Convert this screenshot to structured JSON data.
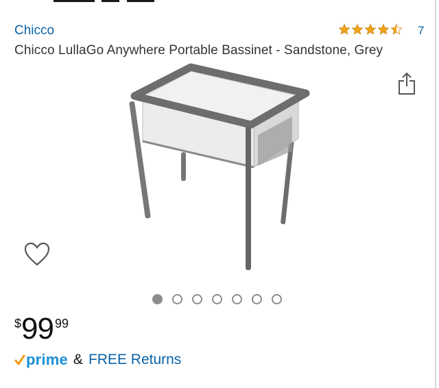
{
  "product": {
    "brand": "Chicco",
    "title": "Chicco LullaGo Anywhere Portable Bassinet - Sandstone, Grey",
    "rating": {
      "stars": 4.5,
      "count": "7"
    },
    "image_alt": "Chicco LullaGo Anywhere Portable Bassinet",
    "carousel": {
      "total": 7,
      "active_index": 0
    },
    "price": {
      "symbol": "$",
      "whole": "99",
      "fraction": "99"
    },
    "shipping": {
      "prime_label": "prime",
      "connector": "&",
      "returns_label": "FREE Returns"
    }
  },
  "colors": {
    "link": "#0b63a8",
    "prime_blue": "#1a8fd6",
    "prime_check": "#f39a16",
    "star": "#f0a418"
  },
  "icons": {
    "share": "share-icon",
    "wishlist": "heart-outline-icon",
    "star": "star-icon"
  }
}
